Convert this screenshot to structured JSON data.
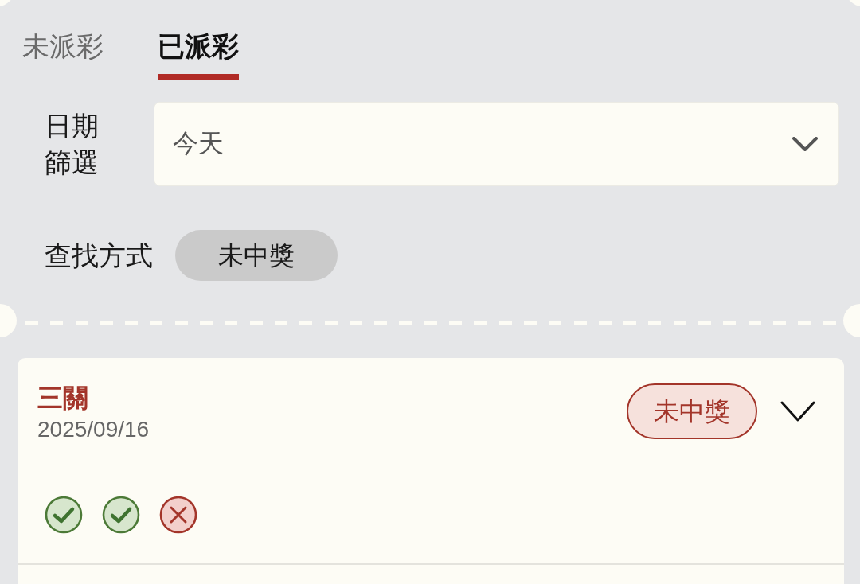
{
  "tabs": [
    {
      "label": "未派彩",
      "selected": false
    },
    {
      "label": "已派彩",
      "selected": true
    }
  ],
  "date_filter": {
    "label": "日期篩選",
    "value": "今天"
  },
  "search_mode": {
    "label": "查找方式",
    "value": "未中獎"
  },
  "results": [
    {
      "title": "三關",
      "date": "2025/09/16",
      "status": "未中獎",
      "expanded": false,
      "legs": [
        {
          "kind": "hit"
        },
        {
          "kind": "hit"
        },
        {
          "kind": "miss"
        }
      ]
    }
  ]
}
